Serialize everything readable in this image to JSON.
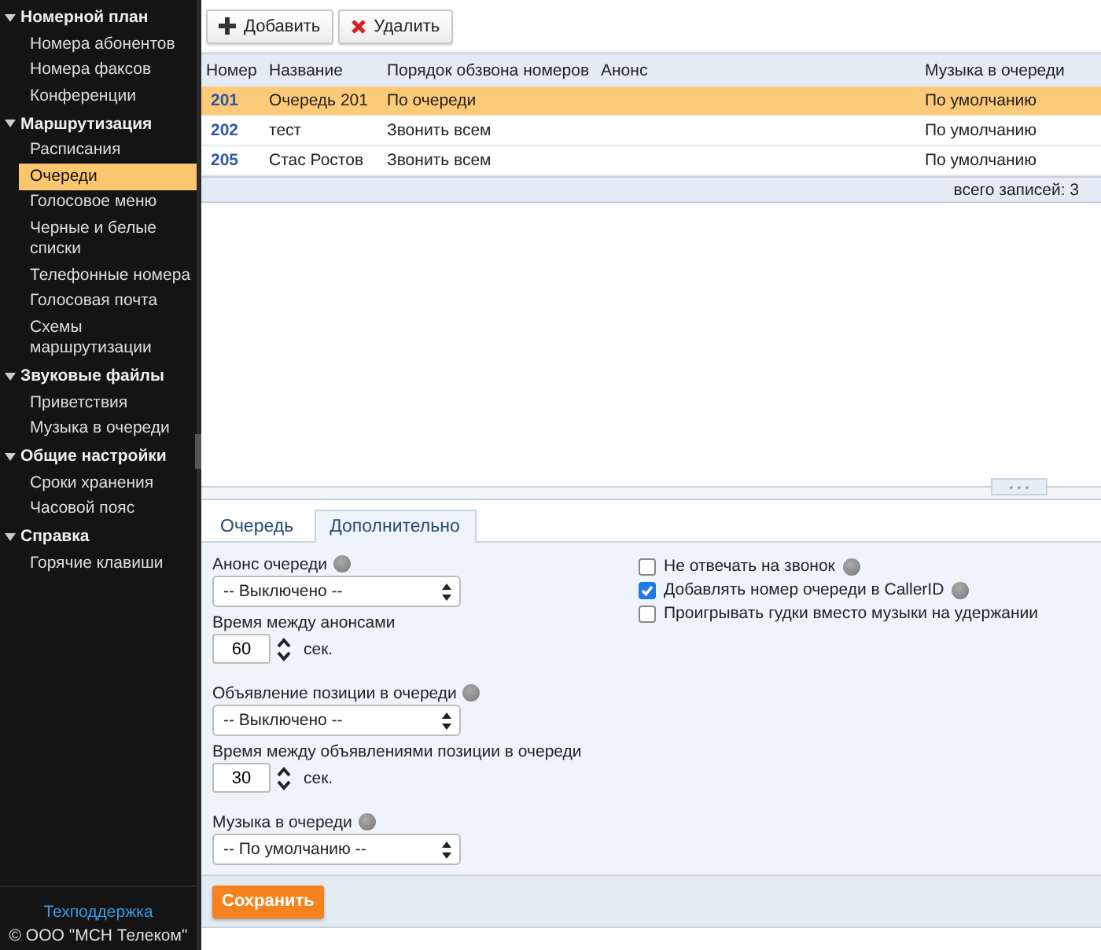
{
  "sidebar": {
    "groups": [
      {
        "label": "Номерной план",
        "expanded": true,
        "items": [
          {
            "label": "Номера абонентов",
            "selected": false
          },
          {
            "label": "Номера факсов",
            "selected": false
          },
          {
            "label": "Конференции",
            "selected": false
          }
        ]
      },
      {
        "label": "Маршрутизация",
        "expanded": true,
        "items": [
          {
            "label": "Расписания",
            "selected": false
          },
          {
            "label": "Очереди",
            "selected": true
          },
          {
            "label": "Голосовое меню",
            "selected": false
          },
          {
            "label": "Черные и белые списки",
            "selected": false
          },
          {
            "label": "Телефонные номера",
            "selected": false
          },
          {
            "label": "Голосовая почта",
            "selected": false
          },
          {
            "label": "Схемы маршрутизации",
            "selected": false
          }
        ]
      },
      {
        "label": "Звуковые файлы",
        "expanded": true,
        "items": [
          {
            "label": "Приветствия",
            "selected": false
          },
          {
            "label": "Музыка в очереди",
            "selected": false
          }
        ]
      },
      {
        "label": "Общие настройки",
        "expanded": true,
        "items": [
          {
            "label": "Сроки хранения",
            "selected": false
          },
          {
            "label": "Часовой пояс",
            "selected": false
          }
        ]
      },
      {
        "label": "Справка",
        "expanded": true,
        "items": [
          {
            "label": "Горячие клавиши",
            "selected": false
          }
        ]
      }
    ],
    "support_link": "Техподдержка",
    "copyright": "© ООО \"МСН Телеком\""
  },
  "toolbar": [
    {
      "label": "Добавить",
      "kind": "add"
    },
    {
      "label": "Удалить",
      "kind": "delete"
    }
  ],
  "table": {
    "columns": [
      "Номер",
      "Название",
      "Порядок обзвона номеров",
      "Анонс",
      "Музыка в очереди"
    ],
    "rows": [
      {
        "cells": [
          "201",
          "Очередь 201",
          "По очереди",
          "",
          "По умолчанию"
        ],
        "selected": true
      },
      {
        "cells": [
          "202",
          "тест",
          "Звонить всем",
          "",
          "По умолчанию"
        ],
        "selected": false
      },
      {
        "cells": [
          "205",
          "Стас Ростов",
          "Звонить всем",
          "",
          "По умолчанию"
        ],
        "selected": false
      }
    ],
    "footer": "всего записей: 3"
  },
  "tabs": [
    {
      "label": "Очередь",
      "selected": false
    },
    {
      "label": "Дополнительно",
      "selected": true
    }
  ],
  "form": {
    "fields": [
      {
        "kind": "select",
        "label": "Анонс очереди",
        "help": true,
        "value": "-- Выключено --"
      },
      {
        "kind": "number",
        "label": "Время между анонсами",
        "help": false,
        "value": "60",
        "unit": "сек."
      },
      {
        "kind": "select",
        "label": "Объявление позиции в очереди",
        "help": true,
        "value": "-- Выключено --"
      },
      {
        "kind": "number",
        "label": "Время между объявлениями позиции в очереди",
        "help": false,
        "value": "30",
        "unit": "сек."
      },
      {
        "kind": "select",
        "label": "Музыка в очереди",
        "help": true,
        "value": "-- По умолчанию --"
      }
    ],
    "checkboxes": [
      {
        "label": "Не отвечать на звонок",
        "checked": false,
        "help": true
      },
      {
        "label": "Добавлять номер очереди в CallerID",
        "checked": true,
        "help": true
      },
      {
        "label": "Проигрывать гудки вместо музыки на удержании",
        "checked": false,
        "help": false
      }
    ],
    "save_button": "Сохранить"
  }
}
